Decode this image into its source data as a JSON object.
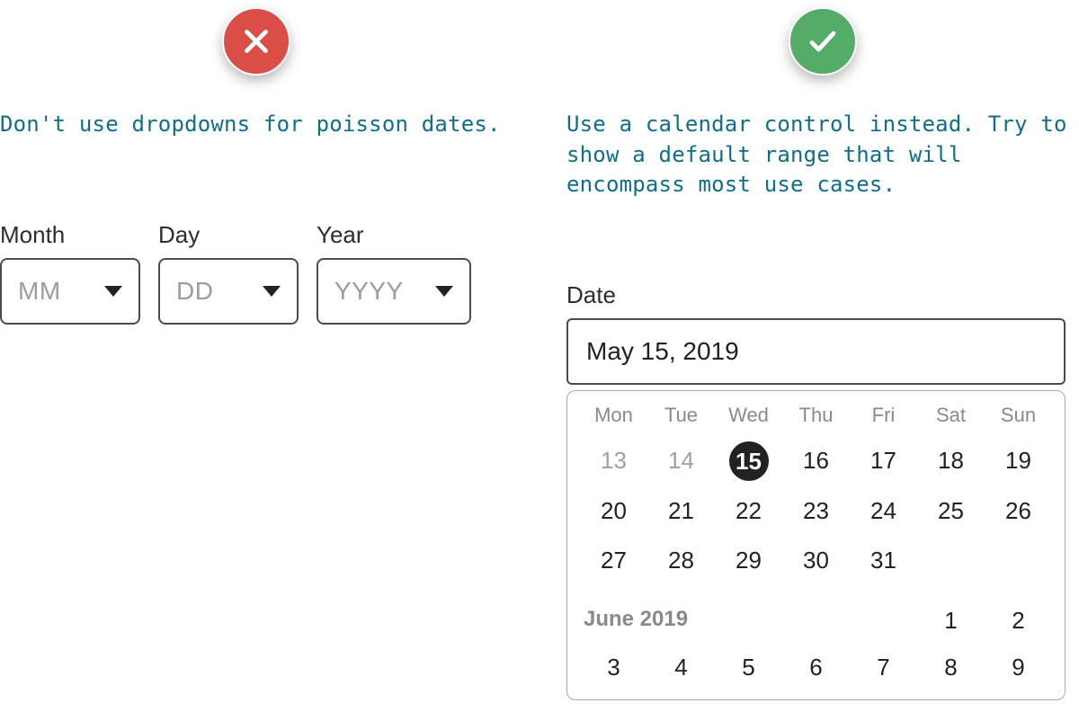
{
  "left": {
    "tip": "Don't use dropdowns for poisson dates.",
    "fields": {
      "month": {
        "label": "Month",
        "placeholder": "MM"
      },
      "day": {
        "label": "Day",
        "placeholder": "DD"
      },
      "year": {
        "label": "Year",
        "placeholder": "YYYY"
      }
    }
  },
  "right": {
    "tip": "Use a calendar control instead. Try to show a default range that will encompass most use cases.",
    "date_label": "Date",
    "date_value": "May 15, 2019",
    "calendar": {
      "weekdays": [
        "Mon",
        "Tue",
        "Wed",
        "Thu",
        "Fri",
        "Sat",
        "Sun"
      ],
      "row1": [
        {
          "n": "13",
          "muted": true
        },
        {
          "n": "14",
          "muted": true
        },
        {
          "n": "15",
          "selected": true
        },
        {
          "n": "16"
        },
        {
          "n": "17"
        },
        {
          "n": "18"
        },
        {
          "n": "19"
        }
      ],
      "row2": [
        "20",
        "21",
        "22",
        "23",
        "24",
        "25",
        "26"
      ],
      "row3": [
        "27",
        "28",
        "29",
        "30",
        "31",
        "",
        ""
      ],
      "next_month_label": "June 2019",
      "next_month_sat": "1",
      "next_month_sun": "2",
      "row4": [
        "3",
        "4",
        "5",
        "6",
        "7",
        "8",
        "9"
      ]
    }
  }
}
